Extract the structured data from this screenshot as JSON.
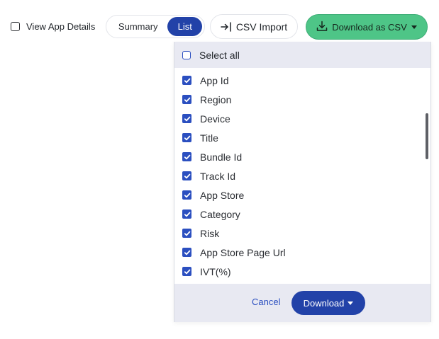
{
  "toolbar": {
    "view_app_details_label": "View App Details",
    "view_app_details_checked": false,
    "segments": [
      {
        "label": "Summary",
        "active": false
      },
      {
        "label": "List",
        "active": true
      }
    ],
    "csv_import_label": "CSV Import",
    "download_csv_label": "Download as CSV"
  },
  "dropdown": {
    "select_all_label": "Select all",
    "select_all_checked": false,
    "options": [
      {
        "label": "App Id",
        "checked": true
      },
      {
        "label": "Region",
        "checked": true
      },
      {
        "label": "Device",
        "checked": true
      },
      {
        "label": "Title",
        "checked": true
      },
      {
        "label": "Bundle Id",
        "checked": true
      },
      {
        "label": "Track Id",
        "checked": true
      },
      {
        "label": "App Store",
        "checked": true
      },
      {
        "label": "Category",
        "checked": true
      },
      {
        "label": "Risk",
        "checked": true
      },
      {
        "label": "App Store Page Url",
        "checked": true
      },
      {
        "label": "IVT(%)",
        "checked": true
      }
    ],
    "cancel_label": "Cancel",
    "download_label": "Download"
  },
  "icons": {
    "csv_import": "import-arrow-icon",
    "download": "download-icon",
    "caret": "caret-down-icon",
    "check": "check-icon"
  },
  "colors": {
    "primary": "#2242a8",
    "download_csv_bg": "#4ec587",
    "panel_bg": "#e8e9f2"
  }
}
